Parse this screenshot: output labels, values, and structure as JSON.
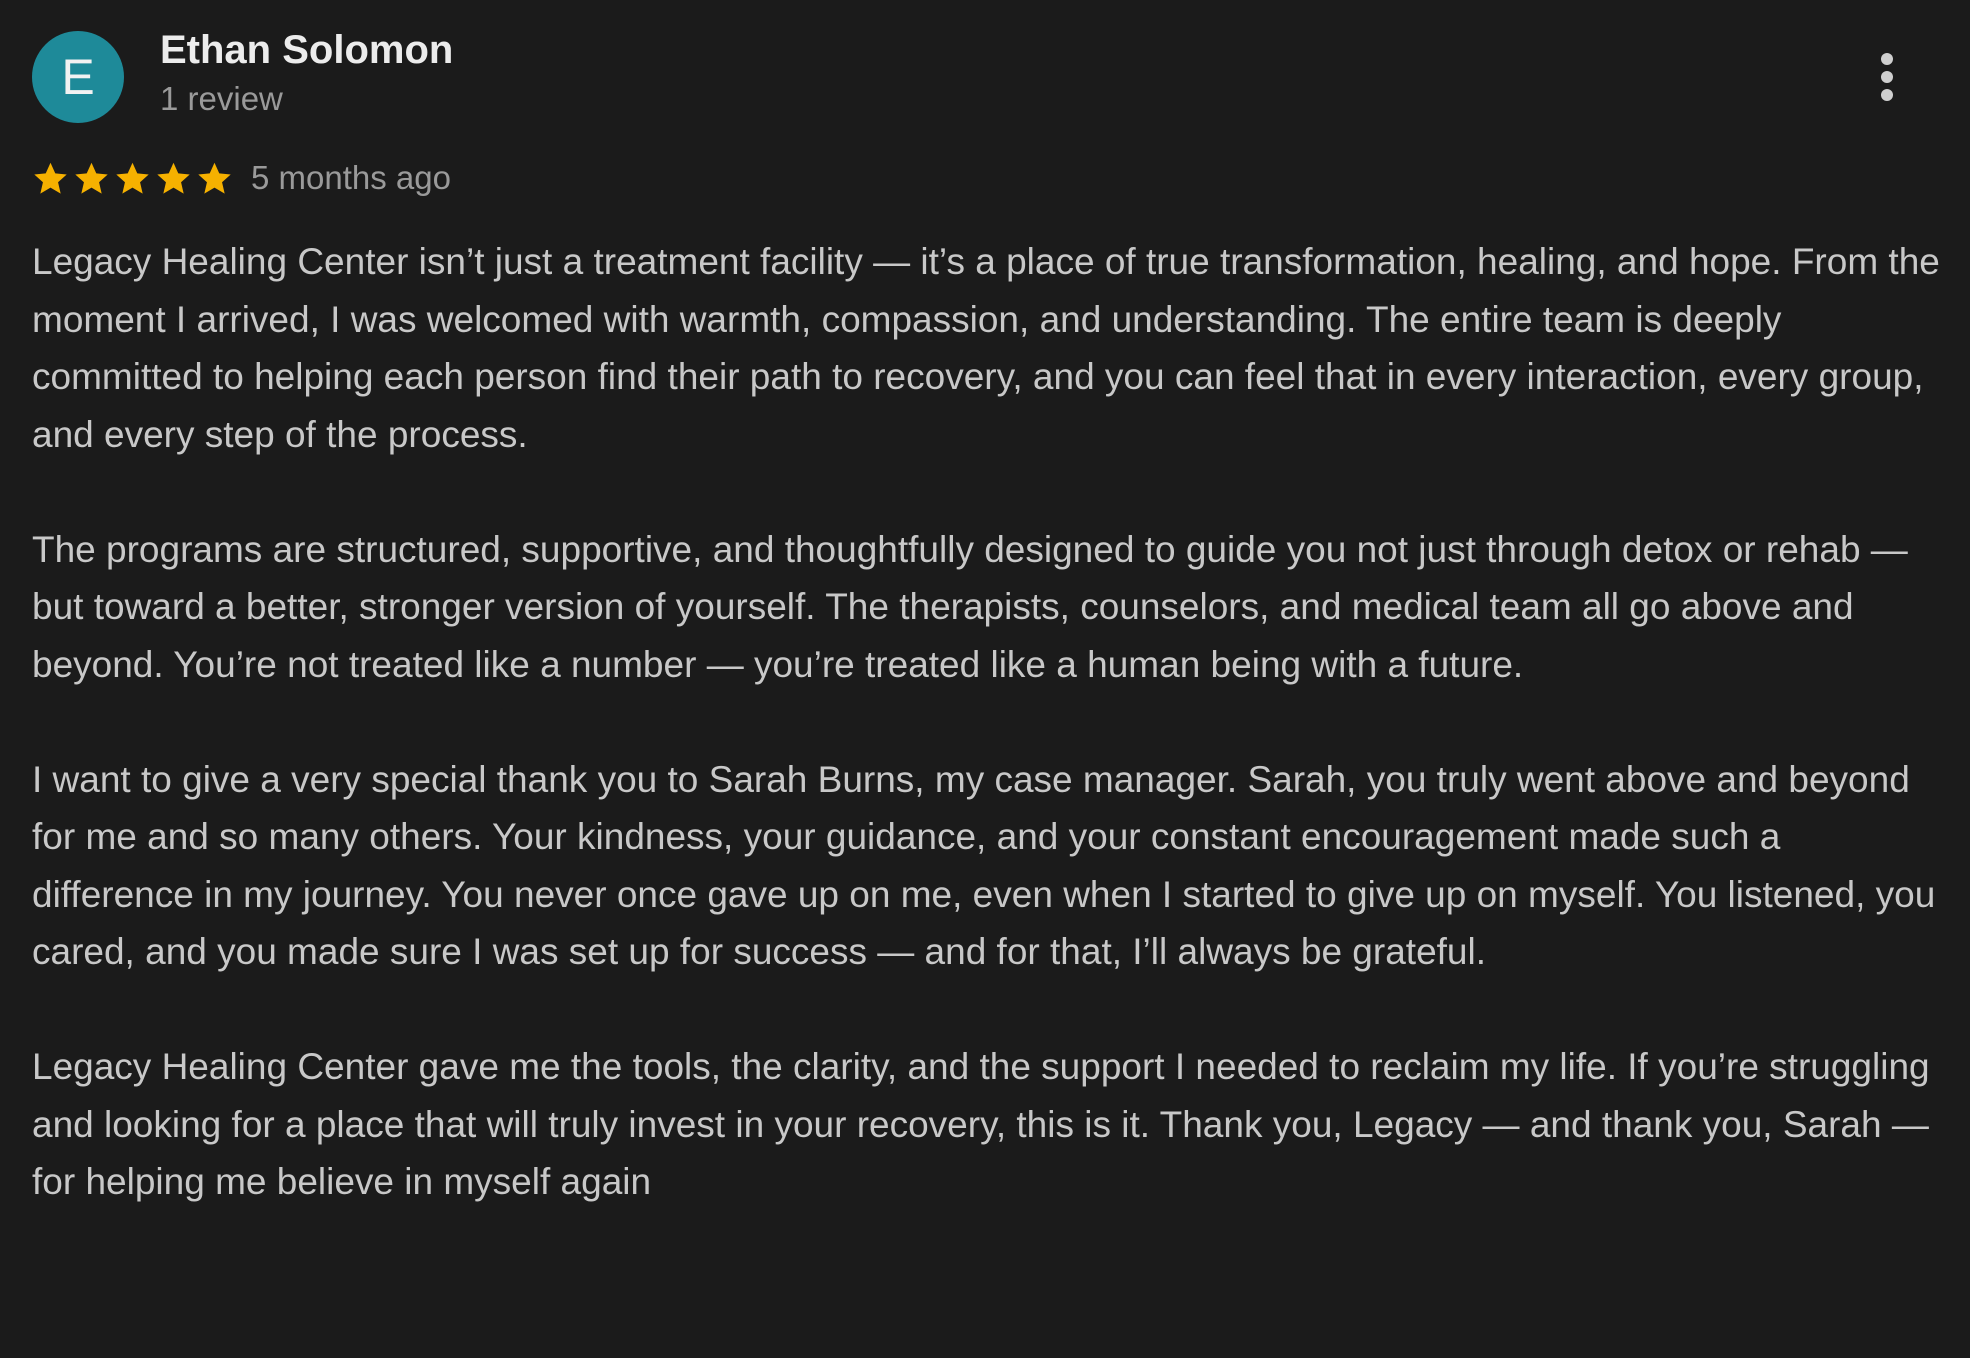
{
  "review": {
    "avatar_letter": "E",
    "avatar_color": "#1e8a99",
    "reviewer_name": "Ethan Solomon",
    "review_count": "1 review",
    "rating": 5,
    "rating_max": 5,
    "star_color": "#f6b100",
    "date": "5 months ago",
    "more_options_icon": "more-vert-icon",
    "paragraphs": [
      "Legacy Healing Center isn’t just a treatment facility — it’s a place of true transformation, healing, and hope. From the moment I arrived, I was welcomed with warmth, compassion, and understanding. The entire team is deeply committed to helping each person find their path to recovery, and you can feel that in every interaction, every group, and every step of the process.",
      "The programs are structured, supportive, and thoughtfully designed to guide you not just through detox or rehab — but toward a better, stronger version of yourself. The therapists, counselors, and medical team all go above and beyond. You’re not treated like a number — you’re treated like a human being with a future.",
      "I want to give a very special thank you to Sarah Burns, my case manager. Sarah, you truly went above and beyond for me and so many others. Your kindness, your guidance, and your constant encouragement made such a difference in my journey. You never once gave up on me, even when I started to give up on myself. You listened, you cared, and you made sure I was set up for success — and for that, I’ll always be grateful.",
      "Legacy Healing Center gave me the tools, the clarity, and the support I needed to reclaim my life. If you’re struggling and looking for a place that will truly invest in your recovery, this is it. Thank you, Legacy — and thank you, Sarah — for helping me believe in myself again"
    ]
  }
}
